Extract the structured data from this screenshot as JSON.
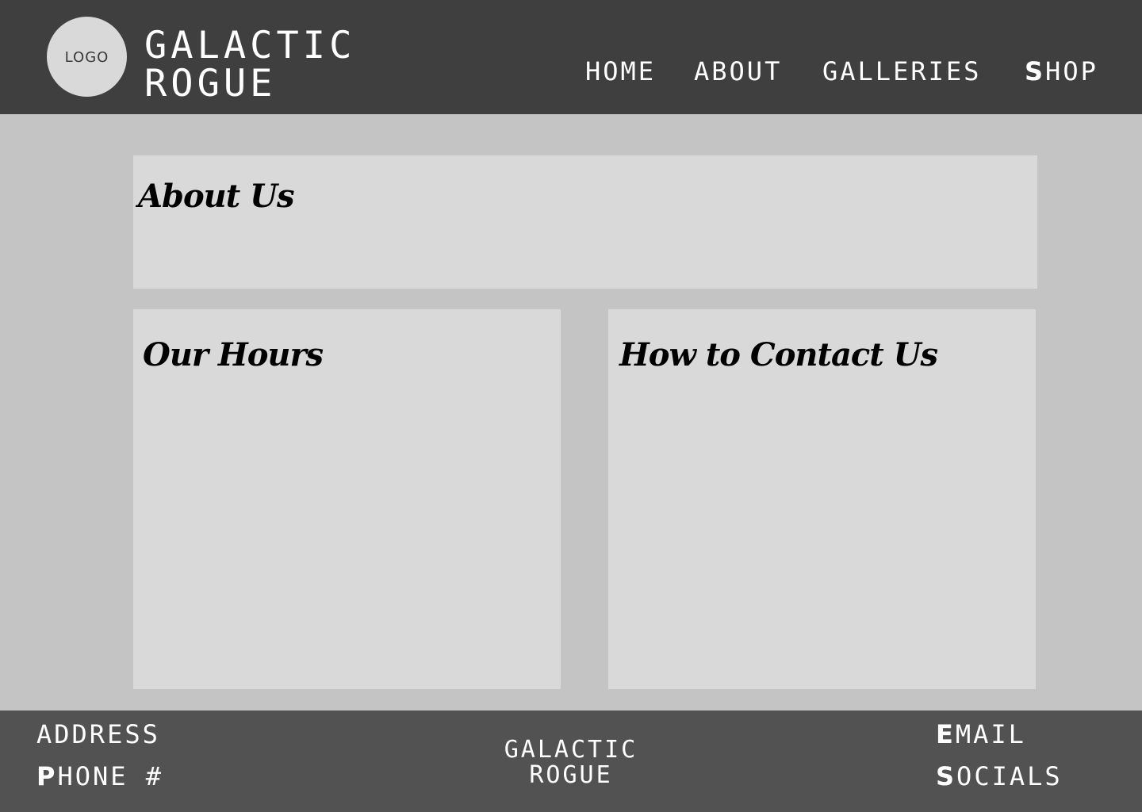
{
  "header": {
    "logo_label": "LOGO",
    "brand_line1": "GALACTIC",
    "brand_line2": "ROGUE",
    "nav": {
      "home": "HOME",
      "about": "ABOUT",
      "galleries": "GALLERIES",
      "shop_first": "S",
      "shop_rest": "HOP"
    }
  },
  "main": {
    "about_title": "About Us",
    "hours_title": "Our Hours",
    "contact_title": "How to Contact Us"
  },
  "footer": {
    "address": "ADDRESS",
    "phone_first": "P",
    "phone_rest": "HONE #",
    "brand_line1": "GALACTIC",
    "brand_line2": "ROGUE",
    "email_first": "E",
    "email_rest": "MAIL",
    "socials_first": "S",
    "socials_rest": "OCIALS"
  },
  "colors": {
    "header_bg": "#3f3f3f",
    "page_bg": "#c4c4c4",
    "card_bg": "#d9d9d9",
    "footer_bg": "#525252"
  }
}
